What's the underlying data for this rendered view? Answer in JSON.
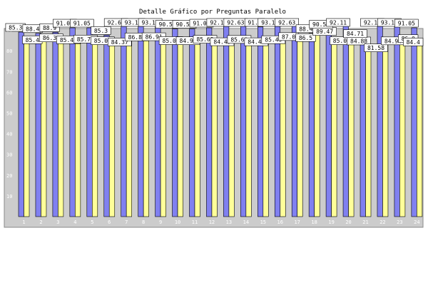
{
  "chart_data": {
    "type": "bar",
    "title": "Detalle Gráfico por Preguntas Paralelo",
    "categories": [
      "1",
      "2",
      "3",
      "4",
      "5",
      "6",
      "7",
      "8",
      "9",
      "10",
      "11",
      "12",
      "13",
      "14",
      "15",
      "16",
      "17",
      "18",
      "19",
      "20",
      "21",
      "22",
      "23",
      "24"
    ],
    "y_ticks": [
      "10",
      "20",
      "30",
      "40",
      "50",
      "60",
      "70",
      "80",
      "90"
    ],
    "ylim": [
      0,
      100
    ],
    "grid": false,
    "legend": "none",
    "series": [
      {
        "color": "#8080f0",
        "values": [
          89.0,
          88.4,
          88.9,
          91.05,
          91.05,
          87.5,
          92.63,
          93.16,
          93.16,
          90.53,
          90.53,
          91.05,
          92.11,
          92.63,
          91.5,
          93.16,
          92.63,
          88.4,
          90.53,
          92.11,
          86.0,
          92.11,
          93.16,
          91.05
        ],
        "labels": [
          "85.3",
          "88.4",
          "88.9",
          "91.05",
          "91.05",
          "85.3",
          "92.63",
          "93.16",
          "93.16",
          "90.53",
          "90.53",
          "91.05",
          "92.11",
          "92.63",
          "91.9",
          "93.16",
          "92.63",
          "88.4",
          "90.53",
          "92.11",
          "84.71",
          "92.11",
          "93.16",
          "91.05"
        ]
      },
      {
        "color": "#ffff99",
        "values": [
          85.45,
          86.37,
          85.45,
          85.79,
          85.01,
          84.37,
          86.81,
          86.91,
          85.06,
          84.99,
          85.69,
          84.49,
          85.63,
          84.48,
          85.49,
          87.0,
          86.5,
          89.47,
          85.0,
          84.88,
          81.58,
          84.94,
          86.0,
          84.4
        ],
        "labels": [
          "85.4",
          "86.37",
          "85.45",
          "85.79",
          "85.01",
          "84.37",
          "86.81",
          "86.91",
          "85.06",
          "84.99",
          "85.69",
          "84.49",
          "85.63",
          "84.48",
          "85.49",
          "87.0",
          "86.5",
          "89.47",
          "85.0",
          "84.88",
          "81.58",
          "84.94",
          "86.0",
          "84.4"
        ]
      }
    ]
  },
  "colors": {
    "plot_background": "#cccccc",
    "bar_outline": "#000000",
    "label_box": "#ffffff",
    "tick_text": "#ffffff"
  }
}
